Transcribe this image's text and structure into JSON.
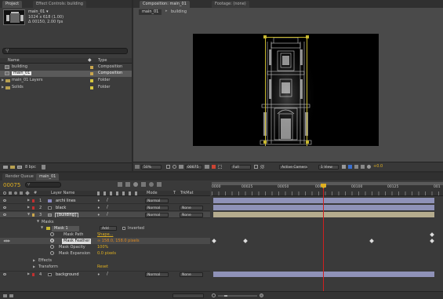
{
  "project_panel": {
    "tabs": [
      "Project",
      "Effect Controls: building"
    ],
    "comp_name": "main_01 ▾",
    "comp_info": [
      "1024 x 618 (1.00)",
      "Δ 00150, 2.00 fps"
    ],
    "search_placeholder": "",
    "columns": {
      "name": "Name",
      "type": "Type"
    },
    "items": [
      {
        "name": "building",
        "type": "Composition",
        "label_color": "#c9a64e"
      },
      {
        "name": "main_01",
        "type": "Composition",
        "label_color": "#c9a64e"
      },
      {
        "name": "main_01 Layers",
        "type": "Folder",
        "label_color": "#d6c640"
      },
      {
        "name": "Solids",
        "type": "Folder",
        "label_color": "#d6c640"
      }
    ],
    "bpc": "8 bpc"
  },
  "comp_panel": {
    "tabs": [
      "Composition: main_01",
      "Footage: (none)"
    ],
    "breadcrumbs": [
      "main_01",
      "building"
    ],
    "zoom": "50%",
    "timecode": "00075",
    "resolution": "Full",
    "camera": "Active Camera",
    "views": "1 View",
    "exposure": "+0.0"
  },
  "timeline": {
    "tabs": [
      "Render Queue",
      "main_01"
    ],
    "current_time": "00075",
    "search_placeholder": "",
    "column_headers": {
      "layer_name": "Layer Name",
      "mode": "Mode",
      "t": "T",
      "trkmat": "TrkMat"
    },
    "ruler": [
      "0000",
      "00025",
      "00050",
      "00075",
      "00100",
      "00125",
      "001"
    ],
    "current_time_fraction": 0.5,
    "layers": [
      {
        "num": "1",
        "name": "archi lines",
        "mode": "Normal",
        "trkmat": ""
      },
      {
        "num": "2",
        "name": "black",
        "mode": "Normal",
        "trkmat": "None"
      },
      {
        "num": "3",
        "name": "[building]",
        "mode": "Normal",
        "trkmat": "None"
      },
      {
        "num": "4",
        "name": "background",
        "mode": "Normal",
        "trkmat": "None"
      }
    ],
    "masks_group": "Masks",
    "mask": {
      "name": "Mask 1",
      "mode": "Add",
      "inverted_label": "Inverted"
    },
    "mask_props": [
      {
        "name": "Mask Path",
        "value": "Shape..."
      },
      {
        "name": "Mask Feather",
        "value": "∞ 158.0, 158.0 pixels"
      },
      {
        "name": "Mask Opacity",
        "value": "100%"
      },
      {
        "name": "Mask Expansion",
        "value": "0.0 pixels"
      }
    ],
    "effects_label": "Effects",
    "transform_label": "Transform",
    "transform_value": "Reset"
  },
  "colors": {
    "accent": "#3a6fd0",
    "playhead": "#d02020",
    "layer_bar": "#8f92b8",
    "layer_bar_sel": "#b5ac8e",
    "mask_path": "#c8b830"
  }
}
